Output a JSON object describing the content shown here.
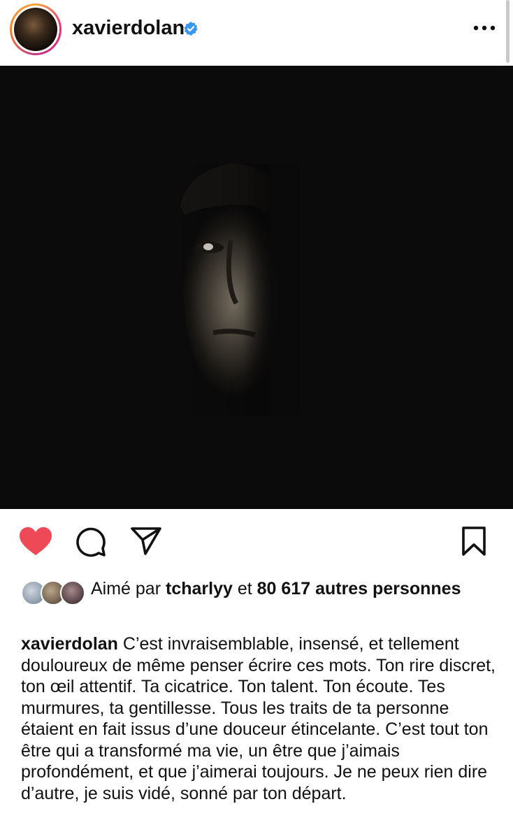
{
  "post": {
    "username": "xavierdolan",
    "verified": true
  },
  "icons": {
    "verified": "verified-badge-icon",
    "more": "more-options-icon",
    "like": "heart-icon",
    "comment": "comment-icon",
    "share": "send-icon",
    "save": "bookmark-icon"
  },
  "colors": {
    "like": "#ed4956",
    "verified": "#3897f0"
  },
  "likes": {
    "prefix": "Aimé par",
    "liker": "tcharlyy",
    "connector": "et",
    "count_text": "80 617 autres personnes"
  },
  "caption": {
    "author": "xavierdolan",
    "text": "C’est invraisemblable, insensé, et tellement douloureux de même penser écrire ces mots. Ton rire discret, ton œil attentif. Ta cicatrice. Ton talent. Ton écoute. Tes murmures, ta gentillesse. Tous les traits de ta personne étaient en fait issus d’une douceur étincelante. C’est tout ton être qui a transformé ma vie, un être que j’aimais profondément, et que j’aimerai toujours. Je ne peux rien dire d’autre, je suis vidé, sonné par ton départ."
  }
}
